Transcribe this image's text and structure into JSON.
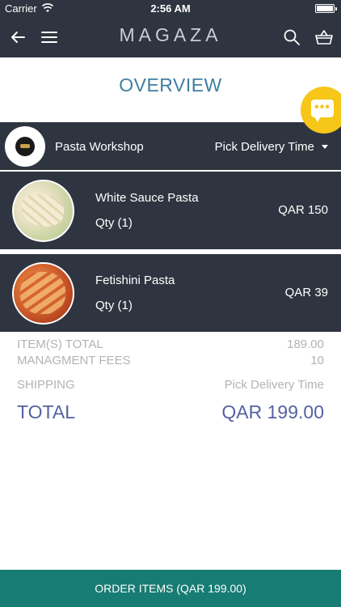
{
  "status": {
    "carrier": "Carrier",
    "time": "2:56 AM"
  },
  "nav": {
    "brand": "MAGAZA"
  },
  "overview": {
    "title": "OVERVIEW"
  },
  "store": {
    "name": "Pasta Workshop",
    "delivery_label": "Pick Delivery Time"
  },
  "items": [
    {
      "name": "White Sauce Pasta",
      "qty": "Qty (1)",
      "price": "QAR 150"
    },
    {
      "name": "Fetishini Pasta",
      "qty": "Qty (1)",
      "price": "QAR 39"
    }
  ],
  "summary": {
    "items_total_label": "ITEM(S) TOTAL",
    "items_total_value": "189.00",
    "fees_label": "MANAGMENT FEES",
    "fees_value": "10",
    "shipping_label": "SHIPPING",
    "shipping_value": "Pick Delivery Time",
    "total_label": "TOTAL",
    "total_value": "QAR 199.00"
  },
  "order_button": {
    "label": "ORDER ITEMS (QAR 199.00)"
  },
  "colors": {
    "dark_bar": "#2f3540",
    "title_blue": "#3e7ea0",
    "total_purple": "#5661a3",
    "fab_yellow": "#f6c619",
    "order_teal": "#177c73"
  },
  "icons": [
    "wifi-icon",
    "battery-icon",
    "back-arrow-icon",
    "hamburger-menu-icon",
    "search-icon",
    "basket-icon",
    "chat-icon",
    "caret-down-icon"
  ]
}
